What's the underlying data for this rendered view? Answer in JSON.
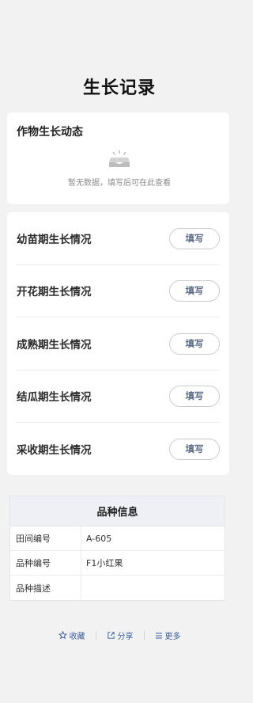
{
  "page": {
    "title": "生长记录"
  },
  "dynamics": {
    "title": "作物生长动态",
    "empty_text": "暂无数据，填写后可在此查看",
    "empty_icon": "empty-box-icon"
  },
  "stages": [
    {
      "label": "幼苗期生长情况",
      "button": "填写"
    },
    {
      "label": "开花期生长情况",
      "button": "填写"
    },
    {
      "label": "成熟期生长情况",
      "button": "填写"
    },
    {
      "label": "结瓜期生长情况",
      "button": "填写"
    },
    {
      "label": "采收期生长情况",
      "button": "填写"
    }
  ],
  "variety": {
    "title": "品种信息",
    "rows": [
      {
        "key": "田间编号",
        "value": "A-605"
      },
      {
        "key": "品种编号",
        "value": "F1小红果"
      },
      {
        "key": "品种描述",
        "value": ""
      }
    ]
  },
  "footer": {
    "favorite": {
      "label": "收藏",
      "icon": "star-icon"
    },
    "share": {
      "label": "分享",
      "icon": "share-icon"
    },
    "more": {
      "label": "更多",
      "icon": "menu-icon"
    }
  },
  "colors": {
    "background": "#f2f2f3",
    "card": "#ffffff",
    "button_text": "#5a6a86",
    "footer_link": "#3a5a9a",
    "table_header": "#eef0f5"
  }
}
